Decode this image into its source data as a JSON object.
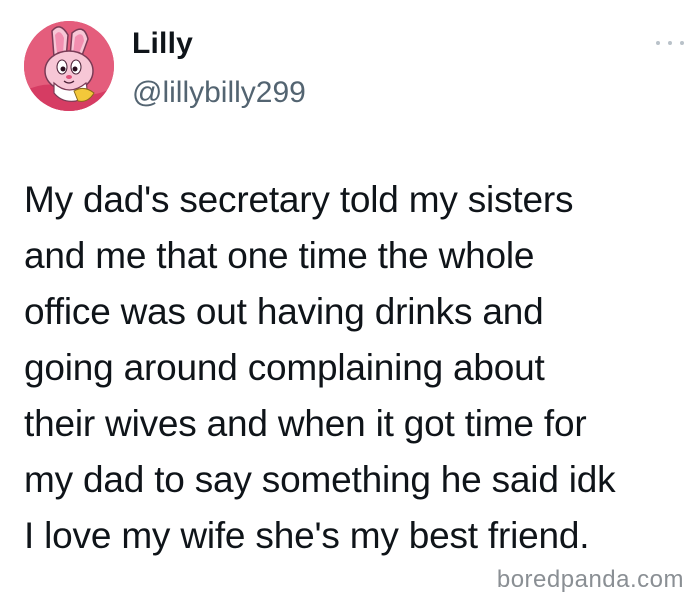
{
  "author": {
    "display_name": "Lilly",
    "handle": "@lillybilly299",
    "avatar_icon": "cartoon-bunny-avatar"
  },
  "menu": {
    "icon": "more-options-icon"
  },
  "tweet": {
    "lines": [
      "My dad's secretary told my sisters",
      "and me that one time the whole",
      "office was out having drinks and",
      "going around complaining about",
      "their wives and when it got time for",
      "my dad to say something he said idk",
      "I love my wife she's my best friend."
    ]
  },
  "watermark": {
    "text": "boredpanda.com"
  },
  "colors": {
    "text": "#0f1419",
    "handle": "#536471",
    "watermark": "#8a8f94"
  }
}
